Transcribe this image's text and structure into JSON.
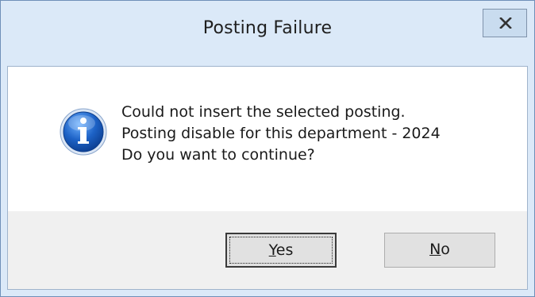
{
  "window": {
    "title": "Posting Failure",
    "close_icon": "close-icon"
  },
  "message": {
    "icon": "info-icon",
    "lines": [
      "Could not insert the selected posting.",
      "Posting disable for this department - 2024",
      "Do you want to continue?"
    ]
  },
  "buttons": {
    "yes": {
      "accel": "Y",
      "rest": "es"
    },
    "no": {
      "accel": "N",
      "rest": "o"
    }
  },
  "colors": {
    "titlebar": "#dbe9f8",
    "button_panel": "#f0f0f0",
    "info_icon": "#1f5fb5"
  }
}
